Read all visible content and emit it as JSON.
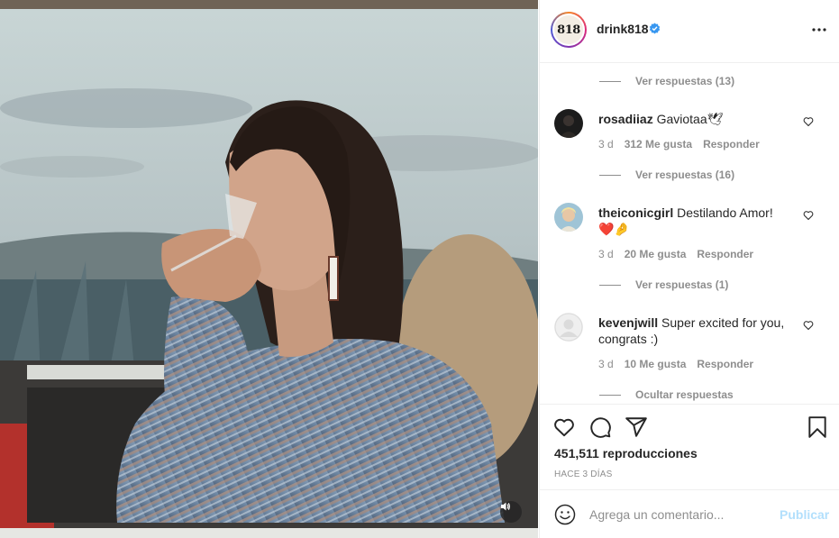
{
  "post": {
    "username": "drink818",
    "avatar_text": "818",
    "verified_icon": "verified-badge-icon",
    "more_icon": "more-options-icon",
    "mute_icon": "speaker-icon"
  },
  "comments": [
    {
      "replies_label": "Ver respuestas (13)"
    },
    {
      "username": "rosadiiaz",
      "text": "Gaviotaa🕊",
      "time": "3 d",
      "likes": "312 Me gusta",
      "reply": "Responder",
      "replies_label": "Ver respuestas (16)"
    },
    {
      "username": "theiconicgirl",
      "text": "Destilando Amor!❤️🤌",
      "time": "3 d",
      "likes": "20 Me gusta",
      "reply": "Responder",
      "replies_label": "Ver respuestas (1)"
    },
    {
      "username": "kevenjwill",
      "text": "Super excited for you, congrats :)",
      "time": "3 d",
      "likes": "10 Me gusta",
      "reply": "Responder",
      "replies_label": "Ocultar respuestas"
    }
  ],
  "actions": {
    "like_icon": "heart-icon",
    "comment_icon": "comment-icon",
    "share_icon": "paper-plane-icon",
    "save_icon": "bookmark-icon",
    "views": "451,511 reproducciones",
    "time_ago": "HACE 3 DÍAS"
  },
  "add_comment": {
    "placeholder": "Agrega un comentario...",
    "publish_label": "Publicar",
    "emoji_icon": "emoji-icon"
  },
  "colors": {
    "verified": "#3897f0",
    "publish_disabled": "#b2dffc",
    "muted_text": "#8e8e8e",
    "heart_red": "#b0171f"
  }
}
